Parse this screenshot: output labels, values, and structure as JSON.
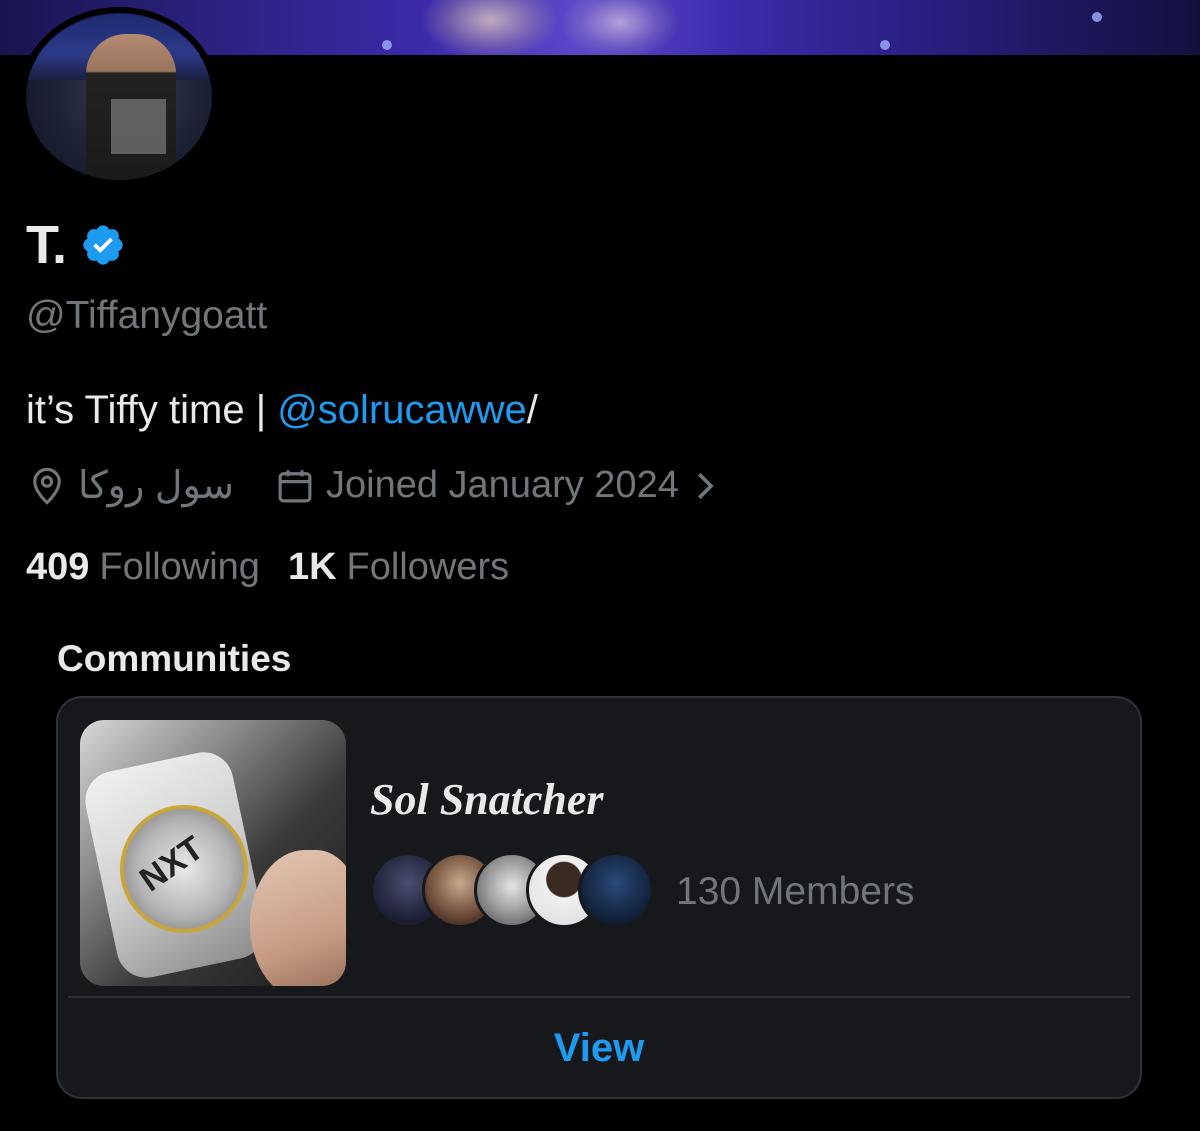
{
  "profile": {
    "display_name": "T.",
    "handle": "@Tiffanygoatt",
    "bio_text": "it’s Tiffy time | ",
    "bio_mention": "@solrucawwe",
    "bio_suffix": "/",
    "location": "سول روكا",
    "joined": "Joined January 2024",
    "following_count": "409",
    "following_label": "Following",
    "followers_count": "1K",
    "followers_label": "Followers"
  },
  "communities": {
    "section_title": "Communities",
    "items": [
      {
        "name": "Sol Snatcher",
        "members": "130 Members",
        "view_label": "View"
      }
    ]
  },
  "colors": {
    "background": "#000000",
    "text_primary": "#e7e9ea",
    "text_secondary": "#71767b",
    "accent": "#1d9bf0",
    "card_bg": "#16181c",
    "card_border": "#2f3336"
  },
  "icons": {
    "verified": "verified-badge-icon",
    "location": "location-pin-icon",
    "calendar": "calendar-icon",
    "chevron": "chevron-right-icon"
  }
}
